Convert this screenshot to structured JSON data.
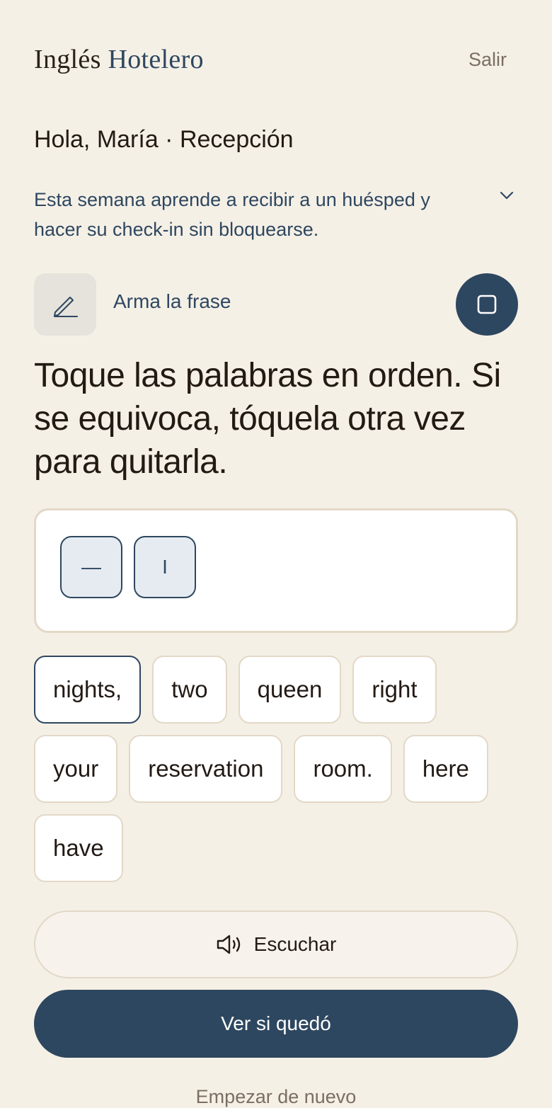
{
  "header": {
    "brand_part1": "Inglés",
    "brand_part2": "Hotelero",
    "logout_label": "Salir"
  },
  "greeting": "Hola, María · Recepción",
  "weekly_goal": {
    "text": "Esta semana aprende a recibir a un huésped y hacer su check-in sin bloquearse.",
    "toggle_icon": "chevron-down-icon"
  },
  "activity": {
    "icon": "pencil-icon",
    "label": "Arma la frase",
    "stop_icon": "stop-icon"
  },
  "instruction": "Toque las palabras en orden. Si se equivoca, tóquela otra vez para quitarla.",
  "answer": {
    "chips": [
      "—",
      "I"
    ]
  },
  "word_bank": {
    "words": [
      "nights,",
      "two",
      "queen",
      "right",
      "your",
      "reservation",
      "room.",
      "here",
      "have"
    ],
    "selected": "nights,"
  },
  "buttons": {
    "listen_label": "Escuchar",
    "listen_icon": "speaker-icon",
    "check_label": "Ver si quedó",
    "restart_label": "Empezar de nuevo"
  },
  "colors": {
    "background": "#f5f0e6",
    "primary": "#2e4760",
    "border": "#e3d8c7",
    "muted": "#7b6e62",
    "text": "#231a14"
  }
}
